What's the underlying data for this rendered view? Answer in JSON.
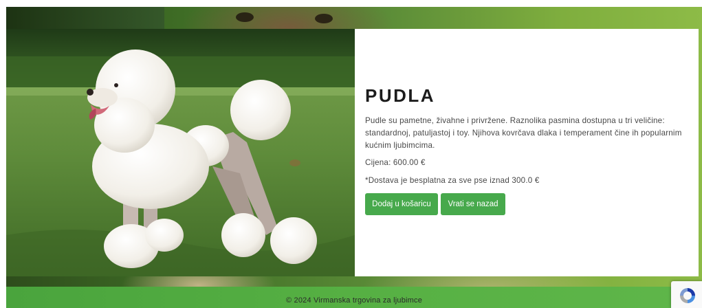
{
  "product": {
    "name": "PUDLA",
    "description": "Pudle su pametne, živahne i privržene. Raznolika pasmina dostupna u tri veličine: standardnoj, patuljastoj i toy. Njihova kovrčava dlaka i temperament čine ih popularnim kućnim ljubimcima.",
    "price_text": "Cijena: 600.00 €",
    "delivery_text": "*Dostava je besplatna za sve pse iznad 300.0 €",
    "image_icon": "poodle-photo"
  },
  "actions": {
    "add_to_cart_label": "Dodaj u košaricu",
    "back_label": "Vrati se nazad"
  },
  "footer": {
    "copyright": "© 2024 Virmanska trgovina za ljubimce"
  },
  "colors": {
    "button_green": "#47a94c",
    "footer_green": "#56b043",
    "title_text": "#1c1c1c"
  },
  "widgets": {
    "recaptcha_icon": "recaptcha-icon"
  }
}
